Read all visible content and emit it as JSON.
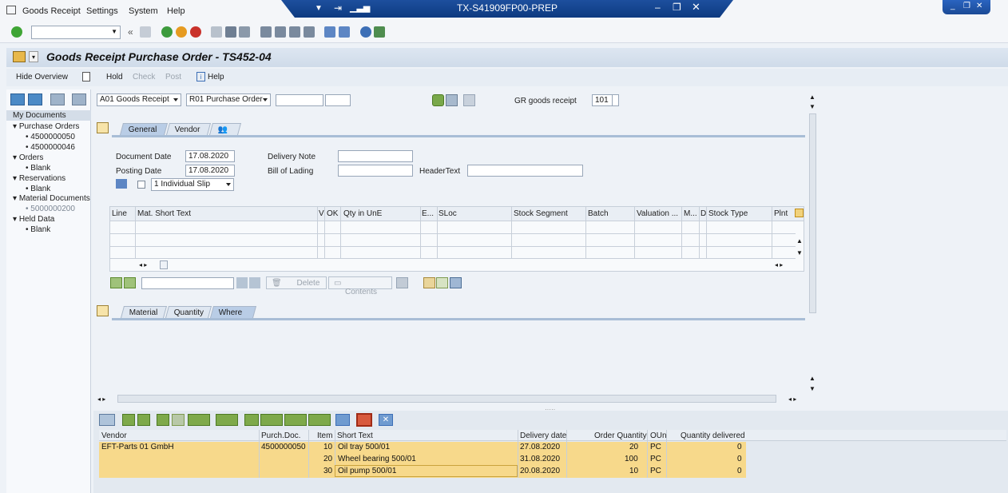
{
  "menu": {
    "items": [
      "Goods Receipt",
      "Settings",
      "System",
      "Help"
    ]
  },
  "window": {
    "system_title": "TX-S41909FP00-PREP"
  },
  "page": {
    "title": "Goods Receipt Purchase Order - TS452-04"
  },
  "app_toolbar": {
    "hide_overview": "Hide Overview",
    "hold": "Hold",
    "check": "Check",
    "post": "Post",
    "help": "Help"
  },
  "nav": {
    "my_documents": "My Documents",
    "purchase_orders": "Purchase Orders",
    "po_1": "4500000050",
    "po_2": "4500000046",
    "orders": "Orders",
    "orders_blank": "Blank",
    "reservations": "Reservations",
    "reservations_blank": "Blank",
    "material_documents": "Material Documents",
    "matdoc_1": "5000000200",
    "held_data": "Held Data",
    "held_blank": "Blank"
  },
  "selection": {
    "action": "A01 Goods Receipt",
    "reference": "R01 Purchase Order",
    "gr_label": "GR goods receipt",
    "movement_type": "101"
  },
  "header_tabs": [
    "General",
    "Vendor"
  ],
  "general": {
    "doc_date_label": "Document Date",
    "doc_date": "17.08.2020",
    "post_date_label": "Posting Date",
    "post_date": "17.08.2020",
    "delivery_note_label": "Delivery Note",
    "bill_of_lading_label": "Bill of Lading",
    "header_text_label": "HeaderText",
    "slip_option": "1 Individual Slip"
  },
  "item_grid": {
    "columns": [
      "Line",
      "Mat. Short Text",
      "V",
      "OK",
      "Qty in UnE",
      "E...",
      "SLoc",
      "Stock Segment",
      "Batch",
      "Valuation ...",
      "M...",
      "D",
      "Stock Type",
      "Plnt"
    ]
  },
  "item_buttons": {
    "delete": "Delete",
    "contents": "Contents"
  },
  "detail_tabs": [
    "Material",
    "Quantity",
    "Where"
  ],
  "po_table": {
    "columns": [
      "Vendor",
      "Purch.Doc.",
      "Item",
      "Short Text",
      "Delivery date",
      "Order Quantity",
      "OUn",
      "Quantity delivered"
    ],
    "rows": [
      {
        "vendor": "EFT-Parts 01 GmbH",
        "doc": "4500000050",
        "item": "10",
        "text": "Oil tray 500/01",
        "date": "27.08.2020",
        "qty": "20",
        "oun": "PC",
        "delivered": "0"
      },
      {
        "vendor": "",
        "doc": "",
        "item": "20",
        "text": "Wheel bearing 500/01",
        "date": "31.08.2020",
        "qty": "100",
        "oun": "PC",
        "delivered": "0"
      },
      {
        "vendor": "",
        "doc": "",
        "item": "30",
        "text": "Oil pump 500/01",
        "date": "20.08.2020",
        "qty": "10",
        "oun": "PC",
        "delivered": "0"
      }
    ]
  },
  "colors": {
    "row_highlight": "#f7d98b",
    "title_bar": "#0d3a80"
  }
}
